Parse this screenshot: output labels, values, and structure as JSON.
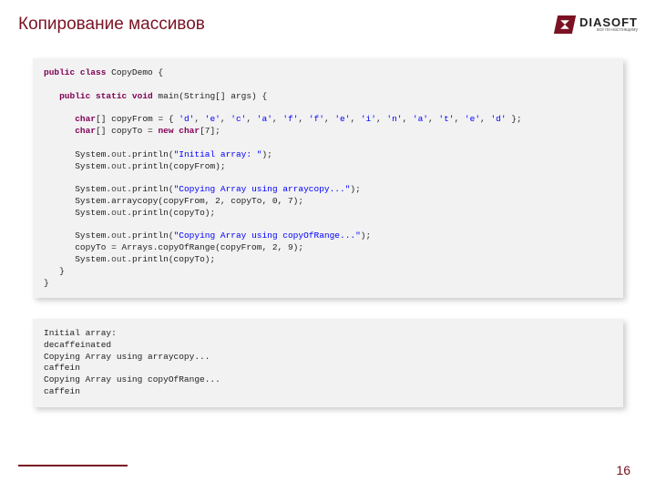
{
  "header": {
    "title": "Копирование массивов",
    "logo_name": "DIASOFT",
    "logo_tag": "всё по-настоящему"
  },
  "code": {
    "l1a": "public class",
    "l1b": " CopyDemo {",
    "l2a": "public static void",
    "l2b": " main(String[] args) {",
    "l3a": "char",
    "l3b": "[] copyFrom = { ",
    "l3c": "'d'",
    "l3d": ", ",
    "l3e": "'e'",
    "l3f": ", ",
    "l3g": "'c'",
    "l3h": ", ",
    "l3i": "'a'",
    "l3j": ", ",
    "l3k": "'f'",
    "l3l": ", ",
    "l3m": "'f'",
    "l3n": ", ",
    "l3o": "'e'",
    "l3p": ", ",
    "l3q": "'i'",
    "l3r": ", ",
    "l3s": "'n'",
    "l3t": ", ",
    "l3u": "'a'",
    "l3v": ", ",
    "l3w": "'t'",
    "l3x": ", ",
    "l3y": "'e'",
    "l3z": ", ",
    "l3aa": "'d'",
    "l3ab": " };",
    "l4a": "char",
    "l4b": "[] copyTo = ",
    "l4c": "new char",
    "l4d": "[7];",
    "l5a": "System.",
    "l5b": "out",
    "l5c": ".println(",
    "l5d": "\"Initial array: \"",
    "l5e": ");",
    "l6a": "System.",
    "l6b": "out",
    "l6c": ".println(copyFrom);",
    "l7a": "System.",
    "l7b": "out",
    "l7c": ".println(",
    "l7d": "\"Copying Array using arraycopy...\"",
    "l7e": ");",
    "l8": "System.arraycopy(copyFrom, 2, copyTo, 0, 7);",
    "l9a": "System.",
    "l9b": "out",
    "l9c": ".println(copyTo);",
    "l10a": "System.",
    "l10b": "out",
    "l10c": ".println(",
    "l10d": "\"Copying Array using copyOfRange...\"",
    "l10e": ");",
    "l11": "copyTo = Arrays.copyOfRange(copyFrom, 2, 9);",
    "l12a": "System.",
    "l12b": "out",
    "l12c": ".println(copyTo);",
    "l13": "}",
    "l14": "}"
  },
  "output": {
    "o1": "Initial array:",
    "o2": "decaffeinated",
    "o3": "Copying Array using arraycopy...",
    "o4": "caffein",
    "o5": "Copying Array using copyOfRange...",
    "o6": "caffein"
  },
  "page_number": "16"
}
